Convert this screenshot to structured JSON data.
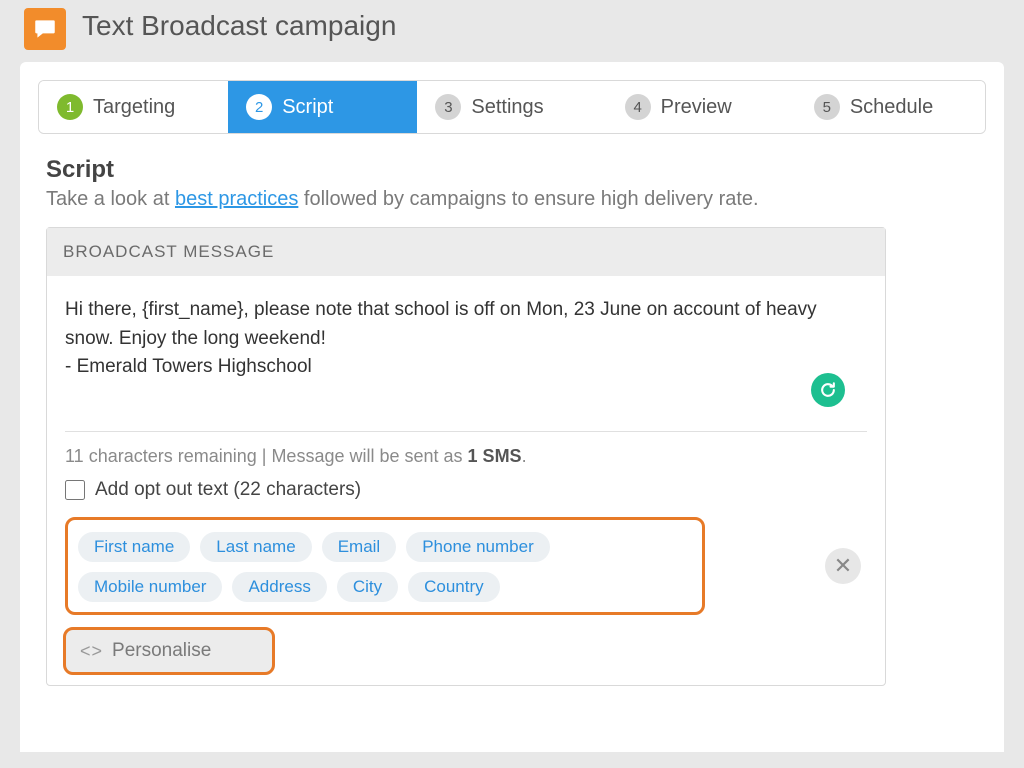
{
  "header": {
    "title": "Text Broadcast campaign"
  },
  "wizard": {
    "steps": [
      {
        "num": "1",
        "label": "Targeting",
        "state": "done"
      },
      {
        "num": "2",
        "label": "Script",
        "state": "active"
      },
      {
        "num": "3",
        "label": "Settings",
        "state": "pending"
      },
      {
        "num": "4",
        "label": "Preview",
        "state": "pending"
      },
      {
        "num": "5",
        "label": "Schedule",
        "state": "pending"
      }
    ]
  },
  "section": {
    "title": "Script",
    "subtext_before": "Take a look at ",
    "subtext_link": "best practices",
    "subtext_after": " followed by campaigns to ensure high delivery rate."
  },
  "message": {
    "panel_title": "BROADCAST MESSAGE",
    "body": "Hi there, {first_name}, please note that school is off on Mon, 23 June on account of heavy snow. Enjoy the long weekend!\n- Emerald Towers Highschool",
    "chars_remaining": "11",
    "stats_prefix": " characters remaining | Message will be sent as ",
    "sms_count": "1 SMS",
    "stats_suffix": ".",
    "optout_label": "Add opt out text (22 characters)",
    "optout_checked": false
  },
  "tokens": [
    "First name",
    "Last name",
    "Email",
    "Phone number",
    "Mobile number",
    "Address",
    "City",
    "Country"
  ],
  "personalise": {
    "label": "Personalise"
  },
  "colors": {
    "accent_orange": "#e77a28",
    "accent_blue": "#2d97e5",
    "accent_green_step": "#7fba2e",
    "grammarly_green": "#1dbf90",
    "icon_orange": "#f28c2b"
  }
}
